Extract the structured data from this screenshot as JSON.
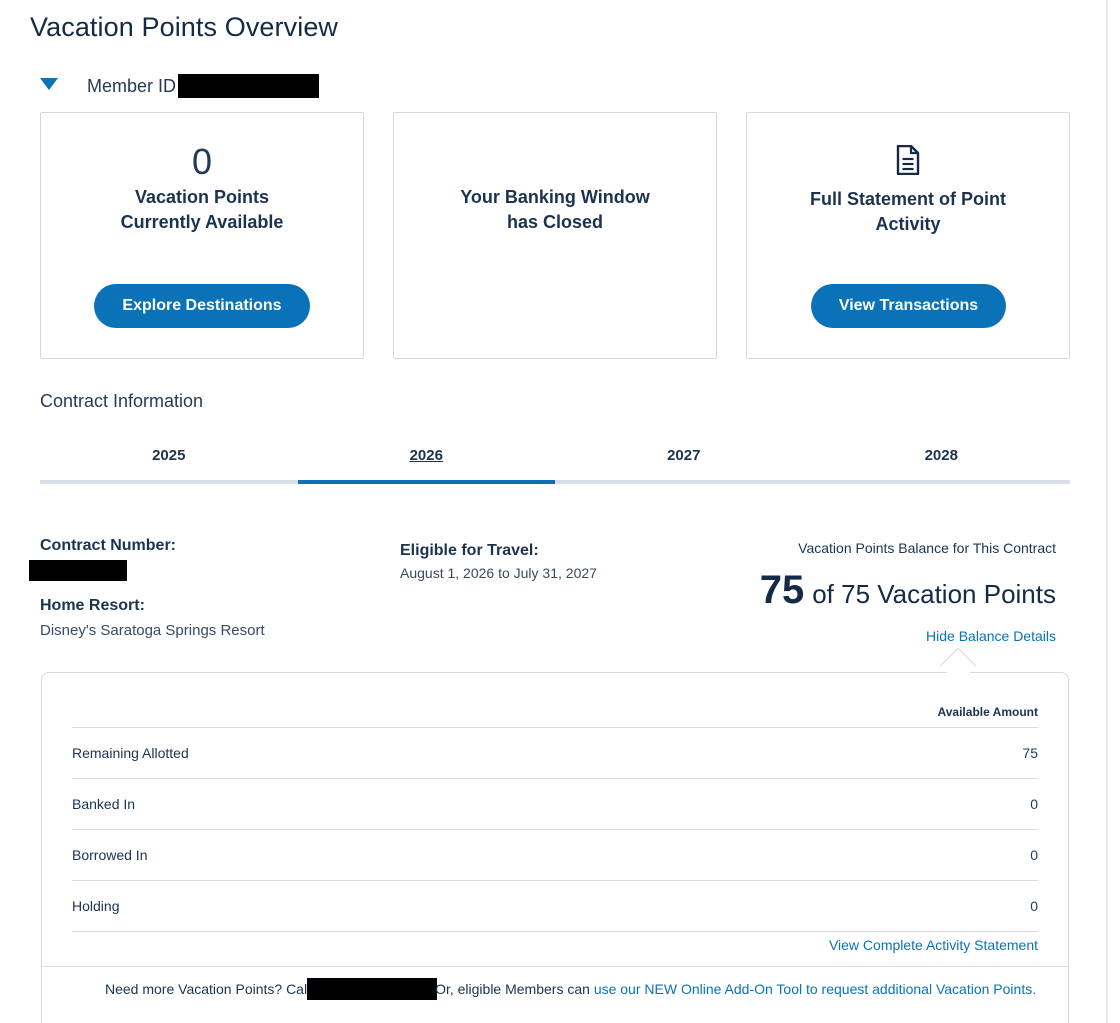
{
  "page": {
    "title": "Vacation Points Overview"
  },
  "member": {
    "label": "Member ID"
  },
  "cards": {
    "available": {
      "points": "0",
      "line1": "Vacation Points",
      "line2": "Currently Available",
      "button": "Explore Destinations"
    },
    "banking": {
      "line1": "Your Banking Window",
      "line2": "has Closed"
    },
    "statement": {
      "icon": "document-icon",
      "line1": "Full Statement of Point",
      "line2": "Activity",
      "button": "View Transactions"
    }
  },
  "contract": {
    "heading": "Contract Information",
    "tabs": [
      {
        "label": "2025",
        "active": false
      },
      {
        "label": "2026",
        "active": true
      },
      {
        "label": "2027",
        "active": false
      },
      {
        "label": "2028",
        "active": false
      }
    ],
    "number_label": "Contract Number:",
    "home_resort_label": "Home Resort:",
    "home_resort_value": "Disney's Saratoga Springs Resort",
    "eligible_label": "Eligible for Travel:",
    "eligible_value": "August 1, 2026 to July 31, 2027",
    "balance_caption": "Vacation Points Balance for This Contract",
    "balance_current": "75",
    "balance_rest": "of 75 Vacation Points",
    "hide_link": "Hide Balance Details"
  },
  "balance_details": {
    "column_header": "Available Amount",
    "rows": [
      {
        "label": "Remaining Allotted",
        "amount": "75"
      },
      {
        "label": "Banked In",
        "amount": "0"
      },
      {
        "label": "Borrowed In",
        "amount": "0"
      },
      {
        "label": "Holding",
        "amount": "0"
      }
    ],
    "statement_link": "View Complete Activity Statement",
    "footer_prefix": "Need more Vacation Points? Cal",
    "footer_middle": "Or, eligible Members can ",
    "footer_link": "use our NEW Online Add-On Tool to request additional Vacation Points."
  },
  "colors": {
    "accent": "#0a73b7",
    "text_dark": "#152a45",
    "border": "#d4d9e0"
  }
}
